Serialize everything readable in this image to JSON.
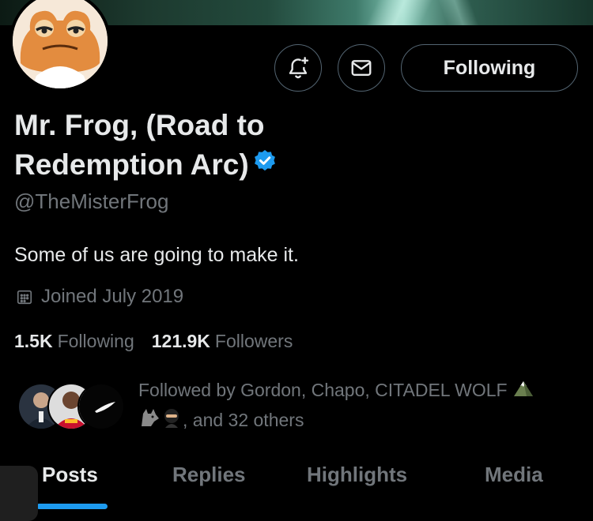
{
  "profile": {
    "name_line1": "Mr. Frog, (Road to",
    "name_line2": "Redemption Arc)",
    "handle": "@TheMisterFrog",
    "bio": "Some of us are going to make it.",
    "joined": "Joined July 2019",
    "following_count": "1.5K",
    "following_label": "Following",
    "followers_count": "121.9K",
    "followers_label": "Followers"
  },
  "actions": {
    "follow_label": "Following"
  },
  "followed_by": {
    "line1": "Followed by Gordon, Chapo, CITADEL WOLF",
    "line2": ", and 32 others"
  },
  "tabs": [
    "Posts",
    "Replies",
    "Highlights",
    "Media"
  ],
  "colors": {
    "accent": "#1d9bf0",
    "background": "#000000",
    "secondary_text": "#71767b",
    "avatar_frog": "#e38c3f"
  },
  "icons": [
    "bell-plus-icon",
    "mail-icon",
    "verified-badge-icon",
    "calendar-icon"
  ]
}
